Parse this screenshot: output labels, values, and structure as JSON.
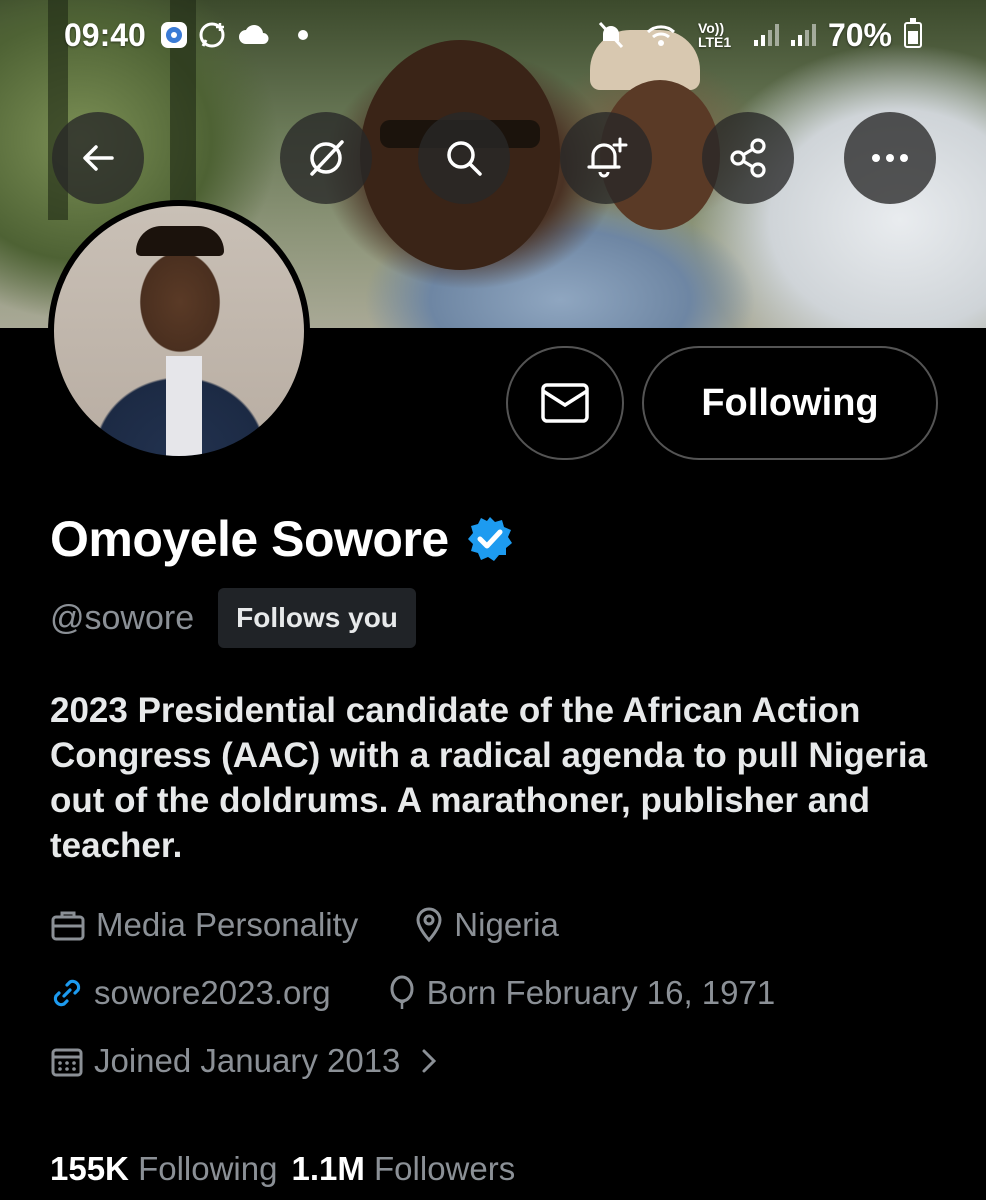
{
  "status_bar": {
    "time": "09:40",
    "network": "Vo)) LTE1",
    "battery": "70%"
  },
  "header_buttons": {
    "back": "back-arrow-icon",
    "grok": "grok-icon",
    "search": "search-icon",
    "notify": "bell-plus-icon",
    "share": "share-icon",
    "more": "more-icon"
  },
  "actions": {
    "message": "envelope-icon",
    "follow_label": "Following"
  },
  "profile": {
    "name": "Omoyele Sowore",
    "verified_color": "#1d9bf0",
    "handle": "@sowore",
    "follows_you": "Follows you",
    "bio": "2023 Presidential candidate of the African Action Congress (AAC) with a radical agenda to pull Nigeria out of the doldrums. A marathoner, publisher and teacher.",
    "profession": "Media Personality",
    "location": "Nigeria",
    "website": "sowore2023.org",
    "birthday": "Born February 16, 1971",
    "joined": "Joined January 2013"
  },
  "stats": {
    "following_count": "155K",
    "following_label": "Following",
    "followers_count": "1.1M",
    "followers_label": "Followers"
  },
  "colors": {
    "background": "#000000",
    "secondary_text": "#8b9096",
    "accent": "#1d9bf0"
  }
}
